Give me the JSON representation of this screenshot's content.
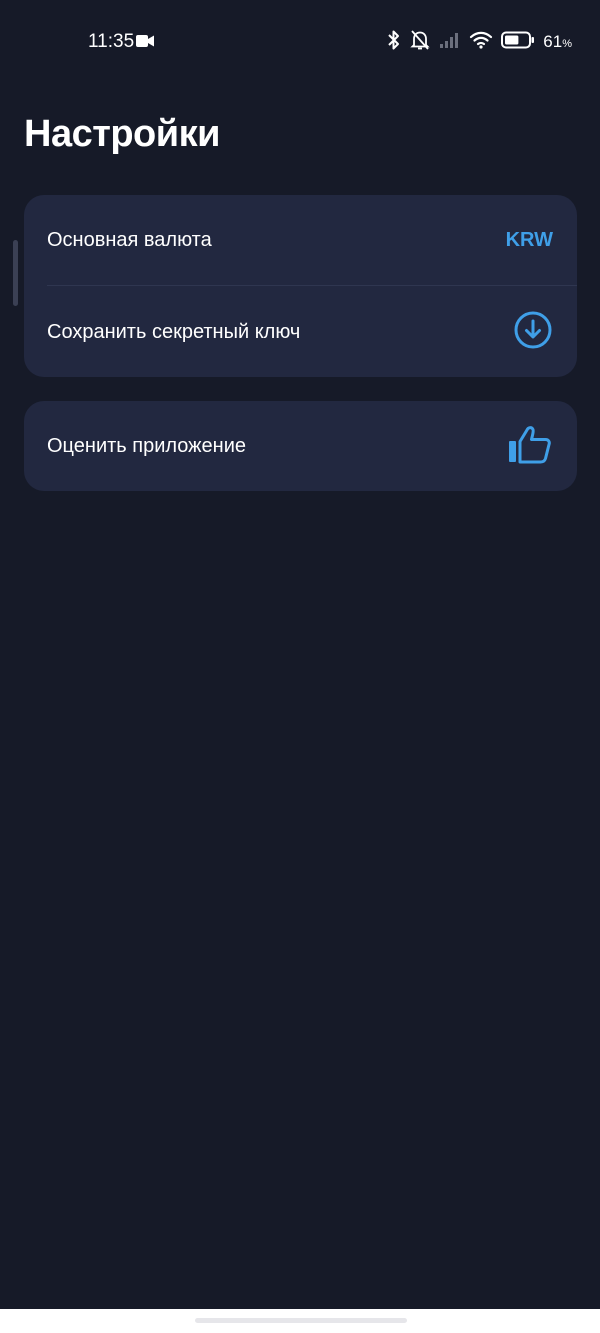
{
  "status_bar": {
    "time": "11:35",
    "battery_percent": "61",
    "battery_unit": "%",
    "battery_level": 0.61,
    "icons": [
      "video-camera-icon",
      "bluetooth-icon",
      "bell-muted-icon",
      "cellular-signal-icon",
      "wifi-icon",
      "battery-icon"
    ]
  },
  "page": {
    "title": "Настройки"
  },
  "settings": {
    "base_currency": {
      "label": "Основная валюта",
      "value": "KRW"
    },
    "save_secret_key": {
      "label": "Сохранить секретный ключ",
      "icon": "download-circle-icon"
    },
    "rate_app": {
      "label": "Оценить приложение",
      "icon": "thumbs-up-icon"
    }
  },
  "colors": {
    "background": "#161a28",
    "card": "#222840",
    "accent": "#3f9fe8"
  }
}
